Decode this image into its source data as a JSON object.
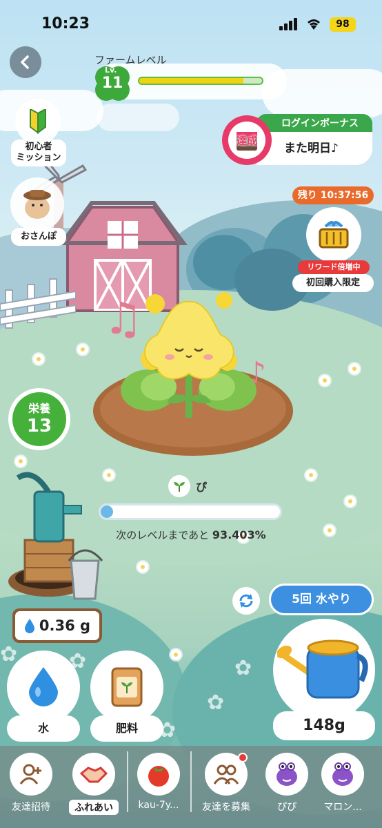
{
  "status_bar": {
    "time": "10:23",
    "battery": "98"
  },
  "header": {
    "farm_level_label": "ファームレベル",
    "lv_prefix": "Lv.",
    "level": "11",
    "level_progress": 0.85
  },
  "side_menu": {
    "beginner_mission": "初心者\nミッション",
    "walk": "おさんぽ"
  },
  "login_bonus": {
    "title": "ログインボーナス",
    "badge": "達成",
    "message": "また明日♪"
  },
  "reward": {
    "timer": "残り 10:37:56",
    "tag": "リワード倍増中",
    "subtitle": "初回購入限定"
  },
  "nutrition": {
    "label": "栄養",
    "value": "13"
  },
  "plant": {
    "name": "ぴ",
    "growth_progress": 0.07,
    "next_level_text": "次のレベルまであと",
    "next_level_percent": "93.403%"
  },
  "water": {
    "amount": "0.36 g",
    "water5_button": "5回 水やり",
    "water_label": "水",
    "fertilizer_label": "肥料",
    "can_amount": "148g"
  },
  "bottom_nav": [
    {
      "label": "友達招待",
      "icon": "add-friend-icon"
    },
    {
      "label": "ふれあい",
      "icon": "handshake-icon",
      "active": true
    },
    {
      "label": "kau-7y...",
      "icon": "tomato-icon"
    },
    {
      "label": "友達を募集",
      "icon": "recruit-friends-icon"
    },
    {
      "label": "ぴぴ",
      "icon": "purple-monster-icon"
    },
    {
      "label": "マロン...",
      "icon": "purple-monster-icon"
    }
  ],
  "colors": {
    "accent_green": "#45b03a",
    "accent_blue": "#3d90e0",
    "login_pink": "#e83a68",
    "timer_orange": "#e96a2b"
  }
}
